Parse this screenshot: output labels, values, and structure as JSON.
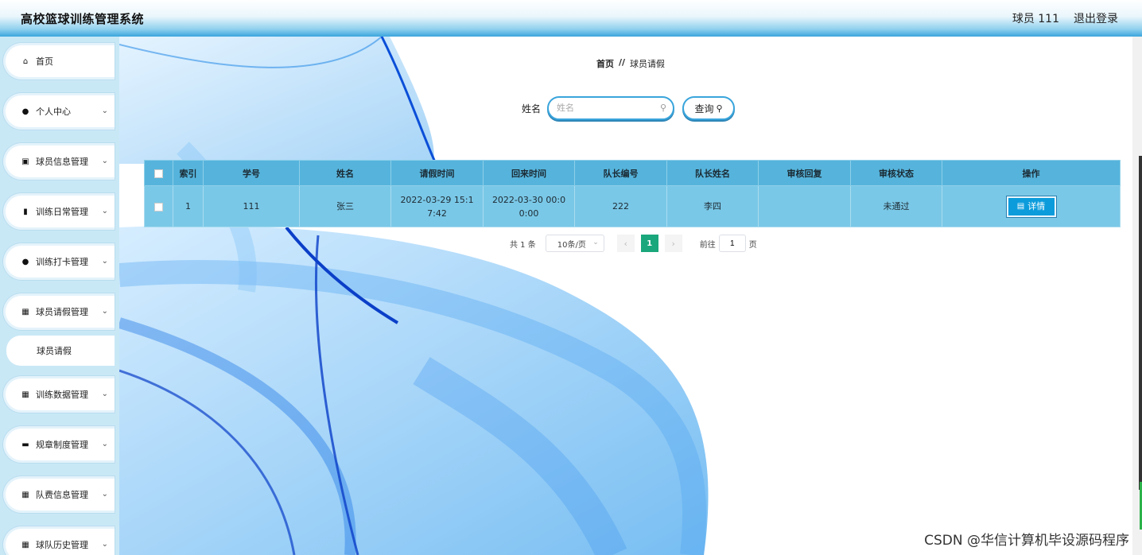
{
  "header": {
    "title": "高校篮球训练管理系统",
    "user": "球员 111",
    "logout": "退出登录"
  },
  "sidebar": {
    "items": [
      {
        "label": "首页",
        "icon": "home-icon",
        "glyph": "⌂",
        "chevron": false
      },
      {
        "label": "个人中心",
        "icon": "user-icon",
        "glyph": "●",
        "chevron": true
      },
      {
        "label": "球员信息管理",
        "icon": "picture-icon",
        "glyph": "▣",
        "chevron": true
      },
      {
        "label": "训练日常管理",
        "icon": "bar-chart-icon",
        "glyph": "▮",
        "chevron": true
      },
      {
        "label": "训练打卡管理",
        "icon": "user-icon",
        "glyph": "●",
        "chevron": true
      },
      {
        "label": "球员请假管理",
        "icon": "grid-icon",
        "glyph": "▦",
        "chevron": true
      },
      {
        "label": "训练数据管理",
        "icon": "grid-icon",
        "glyph": "▦",
        "chevron": true
      },
      {
        "label": "规章制度管理",
        "icon": "monitor-icon",
        "glyph": "▬",
        "chevron": true
      },
      {
        "label": "队费信息管理",
        "icon": "grid-icon",
        "glyph": "▦",
        "chevron": true
      },
      {
        "label": "球队历史管理",
        "icon": "grid-icon",
        "glyph": "▦",
        "chevron": true
      }
    ],
    "sub_item": "球员请假"
  },
  "breadcrumb": {
    "home": "首页",
    "sep": "//",
    "current": "球员请假"
  },
  "search": {
    "label": "姓名",
    "placeholder": "姓名",
    "button": "查询"
  },
  "table": {
    "headers": [
      "索引",
      "学号",
      "姓名",
      "请假时间",
      "回来时间",
      "队长编号",
      "队长姓名",
      "审核回复",
      "审核状态",
      "操作"
    ],
    "rows": [
      {
        "index": "1",
        "student_no": "111",
        "name": "张三",
        "leave_time": "2022-03-29 15:17:42",
        "return_time": "2022-03-30 00:00:00",
        "captain_no": "222",
        "captain_name": "李四",
        "reply": "",
        "status": "未通过",
        "action": "详情"
      }
    ]
  },
  "pagination": {
    "total": "共 1 条",
    "page_size": "10条/页",
    "current_page": "1",
    "goto_label": "前往",
    "goto_value": "1",
    "page_suffix": "页"
  },
  "watermark": "CSDN @华信计算机毕设源码程序",
  "colors": {
    "accent": "#3aa5dc",
    "table_header": "#56b4dc",
    "table_row": "#7ac8e7",
    "detail_button": "#0c9cdc",
    "page_active": "#1aa77b"
  }
}
